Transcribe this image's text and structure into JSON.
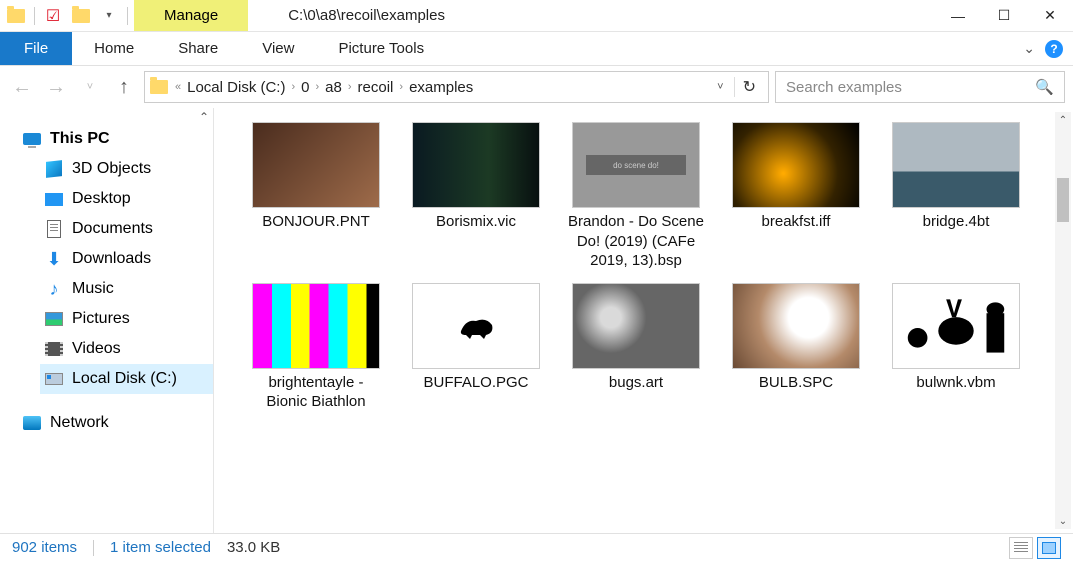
{
  "title_path": "C:\\0\\a8\\recoil\\examples",
  "context_tab": "Manage",
  "context_group": "Picture Tools",
  "ribbon": {
    "file": "File",
    "tabs": [
      "Home",
      "Share",
      "View"
    ]
  },
  "breadcrumbs": [
    "Local Disk (C:)",
    "0",
    "a8",
    "recoil",
    "examples"
  ],
  "search": {
    "placeholder": "Search examples"
  },
  "nav": {
    "root": "This PC",
    "items": [
      "3D Objects",
      "Desktop",
      "Documents",
      "Downloads",
      "Music",
      "Pictures",
      "Videos",
      "Local Disk (C:)"
    ],
    "selected_index": 7,
    "network": "Network"
  },
  "files": [
    {
      "name": "BONJOUR.PNT",
      "art": "art-bonjour"
    },
    {
      "name": "Borismix.vic",
      "art": "art-boris"
    },
    {
      "name": "Brandon - Do Scene Do! (2019) (CAFe 2019, 13).bsp",
      "art": "art-brandon"
    },
    {
      "name": "breakfst.iff",
      "art": "art-break"
    },
    {
      "name": "bridge.4bt",
      "art": "art-bridge"
    },
    {
      "name": "brightentayle - Bionic Biathlon",
      "art": "art-bright"
    },
    {
      "name": "BUFFALO.PGC",
      "art": "art-buff"
    },
    {
      "name": "bugs.art",
      "art": "art-bugs"
    },
    {
      "name": "BULB.SPC",
      "art": "art-bulb"
    },
    {
      "name": "bulwnk.vbm",
      "art": "art-bulw"
    }
  ],
  "status": {
    "count": "902 items",
    "selection": "1 item selected",
    "size": "33.0 KB"
  }
}
